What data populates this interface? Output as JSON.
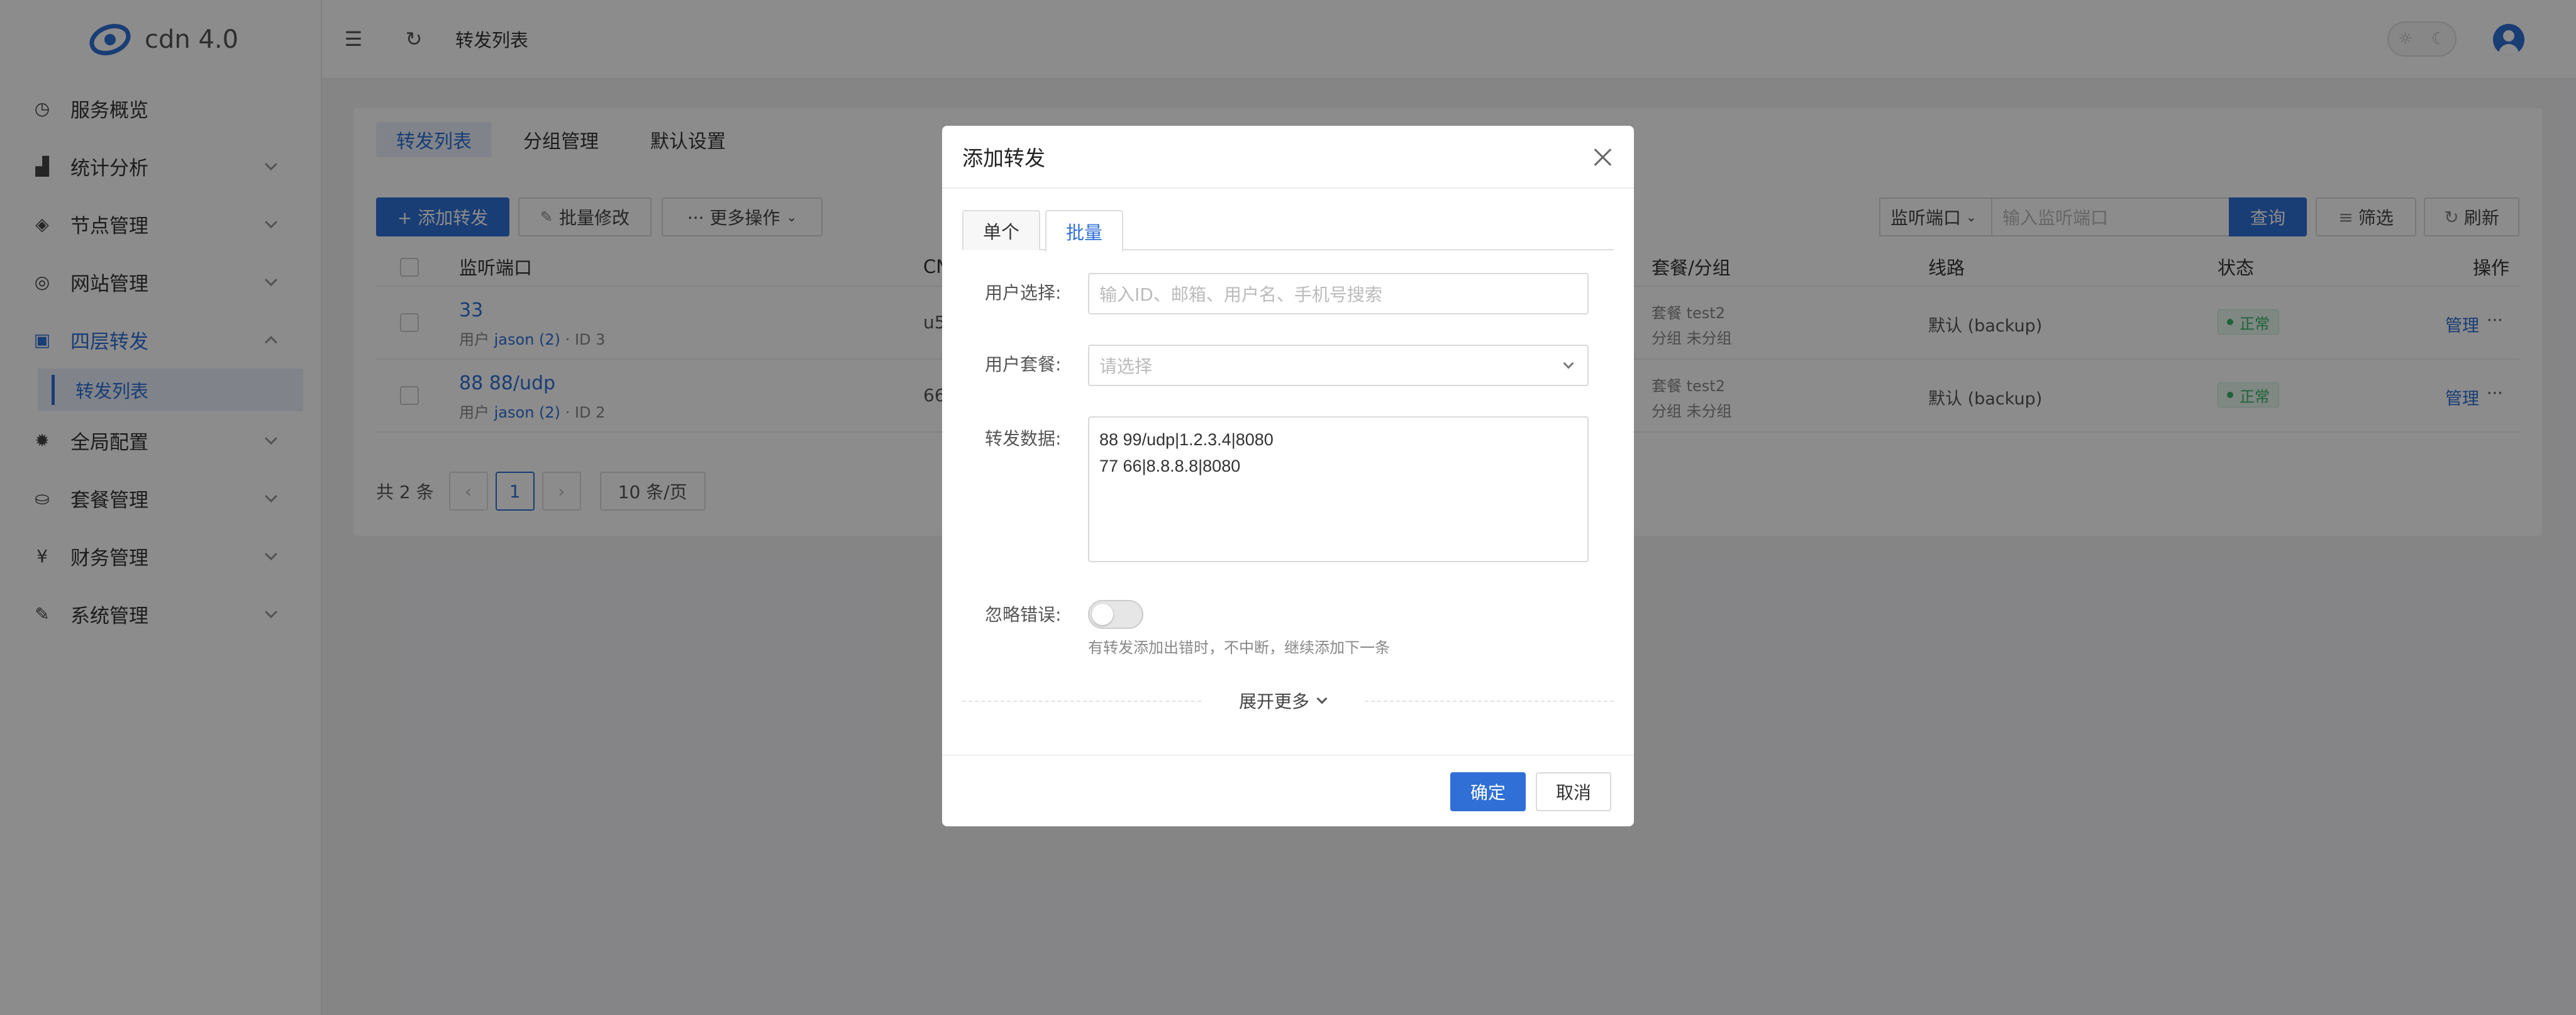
{
  "app": {
    "name": "cdn 4.0"
  },
  "sidebar": {
    "items": [
      {
        "label": "服务概览",
        "icon": "dashboard-icon"
      },
      {
        "label": "统计分析",
        "icon": "chart-icon"
      },
      {
        "label": "节点管理",
        "icon": "layers-icon"
      },
      {
        "label": "网站管理",
        "icon": "globe-icon"
      },
      {
        "label": "四层转发",
        "icon": "forward-icon"
      },
      {
        "label": "全局配置",
        "icon": "gear-icon"
      },
      {
        "label": "套餐管理",
        "icon": "basket-icon"
      },
      {
        "label": "财务管理",
        "icon": "yen-icon"
      },
      {
        "label": "系统管理",
        "icon": "wrench-icon"
      }
    ],
    "submenu": {
      "label": "转发列表"
    }
  },
  "header": {
    "breadcrumb": "转发列表"
  },
  "main": {
    "tabs": [
      "转发列表",
      "分组管理",
      "默认设置"
    ],
    "toolbar": {
      "add": "+ 添加转发",
      "batch_edit": "批量修改",
      "more": "··· 更多操作",
      "filter_select": "监听端口",
      "search_placeholder": "输入监听端口",
      "query": "查询",
      "filter": "筛选",
      "refresh": "刷新"
    },
    "table": {
      "headers": [
        "监听端口",
        "CN",
        "套餐/分组",
        "线路",
        "状态",
        "操作"
      ],
      "rows": [
        {
          "port": "33",
          "user_prefix": "用户",
          "user": "jason (2)",
          "id": "· ID 3",
          "cname": "u5",
          "plan": "套餐 test2",
          "group": "分组 未分组",
          "line": "默认 (backup)",
          "status": "正常",
          "action": "管理",
          "more": "···"
        },
        {
          "port": "88 88/udp",
          "user_prefix": "用户",
          "user": "jason (2)",
          "id": "· ID 2",
          "cname": "66",
          "plan": "套餐 test2",
          "group": "分组 未分组",
          "line": "默认 (backup)",
          "status": "正常",
          "action": "管理",
          "more": "···"
        }
      ]
    },
    "pagination": {
      "total": "共 2 条",
      "prev": "‹",
      "current": "1",
      "next": "›",
      "page_size": "10 条/页"
    }
  },
  "modal": {
    "title": "添加转发",
    "tabs": [
      "单个",
      "批量"
    ],
    "fields": {
      "user_label": "用户选择:",
      "user_placeholder": "输入ID、邮箱、用户名、手机号搜索",
      "plan_label": "用户套餐:",
      "plan_placeholder": "请选择",
      "data_label": "转发数据:",
      "data_value": "88 99/udp|1.2.3.4|8080\n77 66|8.8.8.8|8080",
      "ignore_label": "忽略错误:",
      "ignore_hint": "有转发添加出错时，不中断，继续添加下一条"
    },
    "expand": "展开更多",
    "ok": "确定",
    "cancel": "取消"
  }
}
